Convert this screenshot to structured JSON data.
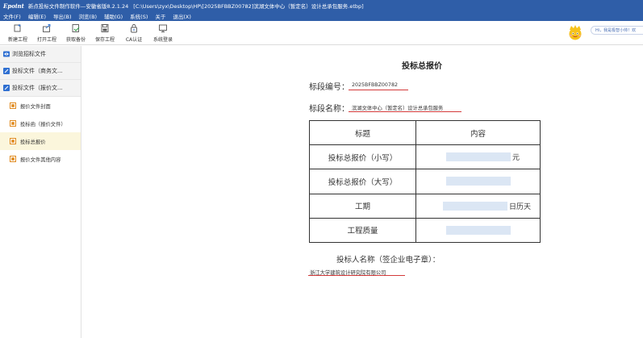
{
  "window": {
    "logo": "Epoint",
    "title": "新点投标文件制作软件—安徽省版8.2.1.24",
    "path": "[C:\\Users\\zyx\\Desktop\\HP\\[2025BFBBZ00782]滨湖文体中心（暂定名）设计总承包服务.etbp]"
  },
  "menu": [
    "文件(F)",
    "编辑(E)",
    "导出(B)",
    "浏览(B)",
    "辅助(G)",
    "系统(S)",
    "关于",
    "退出(X)"
  ],
  "toolbar": [
    {
      "label": "新建工程",
      "icon": "new-project-icon"
    },
    {
      "label": "打开工程",
      "icon": "open-project-icon"
    },
    {
      "label": "获取备份",
      "icon": "get-backup-icon"
    },
    {
      "label": "保存工程",
      "icon": "save-icon"
    },
    {
      "label": "CA认证",
      "icon": "ca-lock-icon"
    },
    {
      "label": "系统登录",
      "icon": "login-monitor-icon"
    }
  ],
  "greeting": "Hi，我是极智小帅！欢",
  "sidebar": {
    "top_items": [
      {
        "label": "浏览招标文件"
      },
      {
        "label": "投标文件（商务文..."
      },
      {
        "label": "投标文件（报价文..."
      }
    ],
    "sub_items": [
      {
        "label": "报价文件封面"
      },
      {
        "label": "投标函（报价文件）"
      },
      {
        "label": "投标总报价"
      },
      {
        "label": "报价文件其他内容"
      }
    ]
  },
  "document": {
    "title": "投标总报价",
    "section_no_label": "标段编号：",
    "section_no_value": "2025BFBBZ00782",
    "section_name_label": "标段名称：",
    "section_name_value": "滨湖文体中心（暂定名）设计总承包服务",
    "table": {
      "headers": [
        "标题",
        "内容"
      ],
      "rows": [
        {
          "label": "投标总报价（小写）",
          "unit": "元"
        },
        {
          "label": "投标总报价（大写）",
          "unit": ""
        },
        {
          "label": "工期",
          "unit": "日历天"
        },
        {
          "label": "工程质量",
          "unit": ""
        }
      ]
    },
    "bidder_label": "投标人名称（签企业电子章）：",
    "bidder_value": "浙江大学建筑设计研究院有限公司"
  },
  "colors": {
    "titlebar": "#2f5ea8",
    "redline": "#d43a3a",
    "blurred_field": "#dbe6f4",
    "active_item": "#fbf6dc"
  }
}
